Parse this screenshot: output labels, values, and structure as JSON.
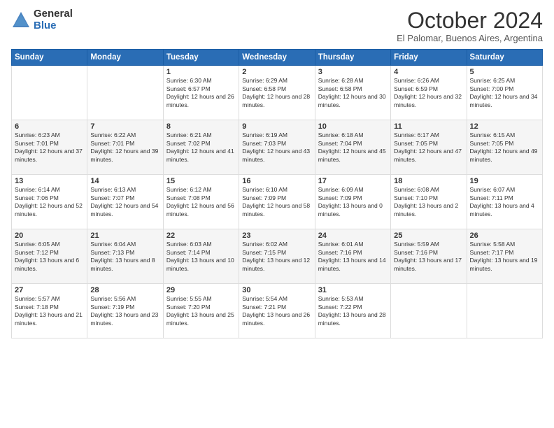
{
  "header": {
    "logo_general": "General",
    "logo_blue": "Blue",
    "month_title": "October 2024",
    "location": "El Palomar, Buenos Aires, Argentina"
  },
  "weekdays": [
    "Sunday",
    "Monday",
    "Tuesday",
    "Wednesday",
    "Thursday",
    "Friday",
    "Saturday"
  ],
  "weeks": [
    [
      {
        "day": "",
        "sunrise": "",
        "sunset": "",
        "daylight": ""
      },
      {
        "day": "",
        "sunrise": "",
        "sunset": "",
        "daylight": ""
      },
      {
        "day": "1",
        "sunrise": "Sunrise: 6:30 AM",
        "sunset": "Sunset: 6:57 PM",
        "daylight": "Daylight: 12 hours and 26 minutes."
      },
      {
        "day": "2",
        "sunrise": "Sunrise: 6:29 AM",
        "sunset": "Sunset: 6:58 PM",
        "daylight": "Daylight: 12 hours and 28 minutes."
      },
      {
        "day": "3",
        "sunrise": "Sunrise: 6:28 AM",
        "sunset": "Sunset: 6:58 PM",
        "daylight": "Daylight: 12 hours and 30 minutes."
      },
      {
        "day": "4",
        "sunrise": "Sunrise: 6:26 AM",
        "sunset": "Sunset: 6:59 PM",
        "daylight": "Daylight: 12 hours and 32 minutes."
      },
      {
        "day": "5",
        "sunrise": "Sunrise: 6:25 AM",
        "sunset": "Sunset: 7:00 PM",
        "daylight": "Daylight: 12 hours and 34 minutes."
      }
    ],
    [
      {
        "day": "6",
        "sunrise": "Sunrise: 6:23 AM",
        "sunset": "Sunset: 7:01 PM",
        "daylight": "Daylight: 12 hours and 37 minutes."
      },
      {
        "day": "7",
        "sunrise": "Sunrise: 6:22 AM",
        "sunset": "Sunset: 7:01 PM",
        "daylight": "Daylight: 12 hours and 39 minutes."
      },
      {
        "day": "8",
        "sunrise": "Sunrise: 6:21 AM",
        "sunset": "Sunset: 7:02 PM",
        "daylight": "Daylight: 12 hours and 41 minutes."
      },
      {
        "day": "9",
        "sunrise": "Sunrise: 6:19 AM",
        "sunset": "Sunset: 7:03 PM",
        "daylight": "Daylight: 12 hours and 43 minutes."
      },
      {
        "day": "10",
        "sunrise": "Sunrise: 6:18 AM",
        "sunset": "Sunset: 7:04 PM",
        "daylight": "Daylight: 12 hours and 45 minutes."
      },
      {
        "day": "11",
        "sunrise": "Sunrise: 6:17 AM",
        "sunset": "Sunset: 7:05 PM",
        "daylight": "Daylight: 12 hours and 47 minutes."
      },
      {
        "day": "12",
        "sunrise": "Sunrise: 6:15 AM",
        "sunset": "Sunset: 7:05 PM",
        "daylight": "Daylight: 12 hours and 49 minutes."
      }
    ],
    [
      {
        "day": "13",
        "sunrise": "Sunrise: 6:14 AM",
        "sunset": "Sunset: 7:06 PM",
        "daylight": "Daylight: 12 hours and 52 minutes."
      },
      {
        "day": "14",
        "sunrise": "Sunrise: 6:13 AM",
        "sunset": "Sunset: 7:07 PM",
        "daylight": "Daylight: 12 hours and 54 minutes."
      },
      {
        "day": "15",
        "sunrise": "Sunrise: 6:12 AM",
        "sunset": "Sunset: 7:08 PM",
        "daylight": "Daylight: 12 hours and 56 minutes."
      },
      {
        "day": "16",
        "sunrise": "Sunrise: 6:10 AM",
        "sunset": "Sunset: 7:09 PM",
        "daylight": "Daylight: 12 hours and 58 minutes."
      },
      {
        "day": "17",
        "sunrise": "Sunrise: 6:09 AM",
        "sunset": "Sunset: 7:09 PM",
        "daylight": "Daylight: 13 hours and 0 minutes."
      },
      {
        "day": "18",
        "sunrise": "Sunrise: 6:08 AM",
        "sunset": "Sunset: 7:10 PM",
        "daylight": "Daylight: 13 hours and 2 minutes."
      },
      {
        "day": "19",
        "sunrise": "Sunrise: 6:07 AM",
        "sunset": "Sunset: 7:11 PM",
        "daylight": "Daylight: 13 hours and 4 minutes."
      }
    ],
    [
      {
        "day": "20",
        "sunrise": "Sunrise: 6:05 AM",
        "sunset": "Sunset: 7:12 PM",
        "daylight": "Daylight: 13 hours and 6 minutes."
      },
      {
        "day": "21",
        "sunrise": "Sunrise: 6:04 AM",
        "sunset": "Sunset: 7:13 PM",
        "daylight": "Daylight: 13 hours and 8 minutes."
      },
      {
        "day": "22",
        "sunrise": "Sunrise: 6:03 AM",
        "sunset": "Sunset: 7:14 PM",
        "daylight": "Daylight: 13 hours and 10 minutes."
      },
      {
        "day": "23",
        "sunrise": "Sunrise: 6:02 AM",
        "sunset": "Sunset: 7:15 PM",
        "daylight": "Daylight: 13 hours and 12 minutes."
      },
      {
        "day": "24",
        "sunrise": "Sunrise: 6:01 AM",
        "sunset": "Sunset: 7:16 PM",
        "daylight": "Daylight: 13 hours and 14 minutes."
      },
      {
        "day": "25",
        "sunrise": "Sunrise: 5:59 AM",
        "sunset": "Sunset: 7:16 PM",
        "daylight": "Daylight: 13 hours and 17 minutes."
      },
      {
        "day": "26",
        "sunrise": "Sunrise: 5:58 AM",
        "sunset": "Sunset: 7:17 PM",
        "daylight": "Daylight: 13 hours and 19 minutes."
      }
    ],
    [
      {
        "day": "27",
        "sunrise": "Sunrise: 5:57 AM",
        "sunset": "Sunset: 7:18 PM",
        "daylight": "Daylight: 13 hours and 21 minutes."
      },
      {
        "day": "28",
        "sunrise": "Sunrise: 5:56 AM",
        "sunset": "Sunset: 7:19 PM",
        "daylight": "Daylight: 13 hours and 23 minutes."
      },
      {
        "day": "29",
        "sunrise": "Sunrise: 5:55 AM",
        "sunset": "Sunset: 7:20 PM",
        "daylight": "Daylight: 13 hours and 25 minutes."
      },
      {
        "day": "30",
        "sunrise": "Sunrise: 5:54 AM",
        "sunset": "Sunset: 7:21 PM",
        "daylight": "Daylight: 13 hours and 26 minutes."
      },
      {
        "day": "31",
        "sunrise": "Sunrise: 5:53 AM",
        "sunset": "Sunset: 7:22 PM",
        "daylight": "Daylight: 13 hours and 28 minutes."
      },
      {
        "day": "",
        "sunrise": "",
        "sunset": "",
        "daylight": ""
      },
      {
        "day": "",
        "sunrise": "",
        "sunset": "",
        "daylight": ""
      }
    ]
  ]
}
